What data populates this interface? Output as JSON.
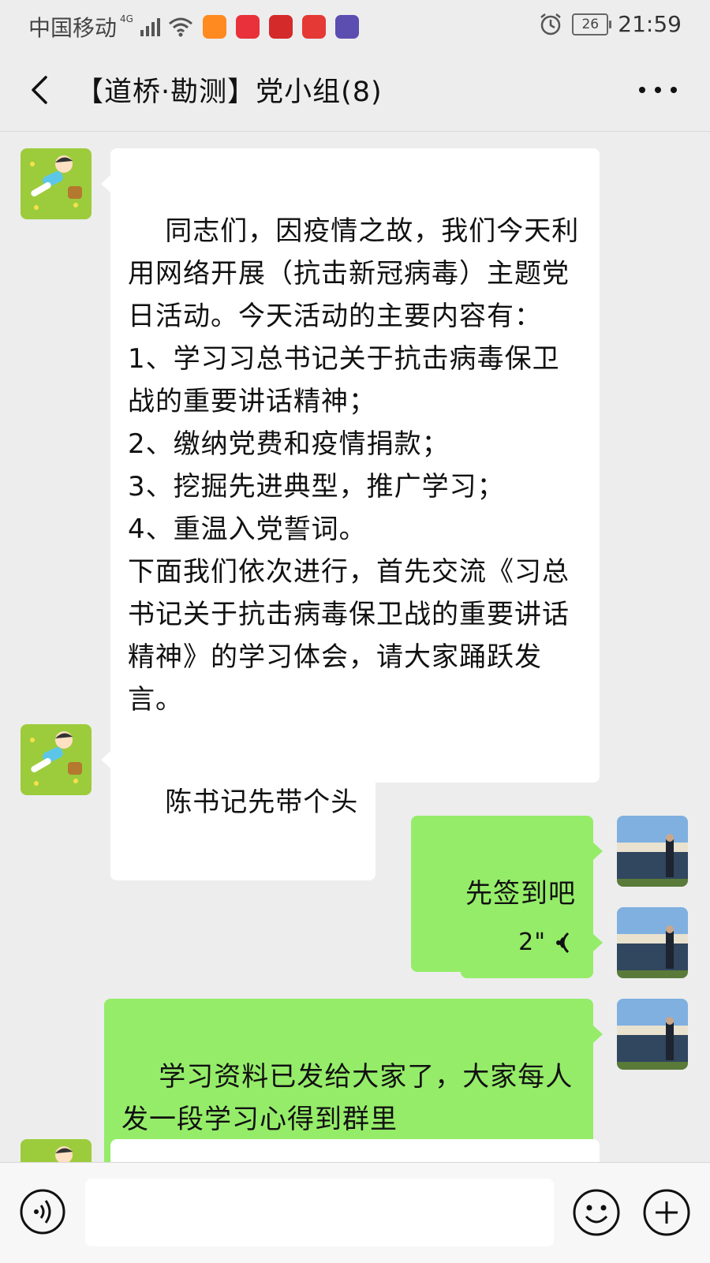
{
  "status_bar": {
    "carrier": "中国移动",
    "network": "4G",
    "battery": "26",
    "time": "21:59"
  },
  "header": {
    "title": "【道桥·勘测】党小组(8)",
    "back_icon": "chevron-left-icon",
    "more_icon": "more-horizontal-icon"
  },
  "messages": [
    {
      "side": "left",
      "text": "同志们，因疫情之故，我们今天利用网络开展（抗击新冠病毒）主题党日活动。今天活动的主要内容有：\n1、学习习总书记关于抗击病毒保卫战的重要讲话精神；\n2、缴纳党费和疫情捐款；\n3、挖掘先进典型，推广学习；\n4、重温入党誓词。\n下面我们依次进行，首先交流《习总书记关于抗击病毒保卫战的重要讲话精神》的学习体会，请大家踊跃发言。"
    },
    {
      "side": "left",
      "text": "陈书记先带个头"
    },
    {
      "side": "right",
      "text": "先签到吧"
    },
    {
      "side": "right",
      "type": "voice",
      "duration": "2\""
    },
    {
      "side": "right",
      "text": "学习资料已发给大家了，大家每人发一段学习心得到群里"
    }
  ],
  "input_bar": {
    "voice_icon": "voice-mode-icon",
    "emoji_icon": "emoji-icon",
    "plus_icon": "plus-circle-icon",
    "placeholder": ""
  },
  "colors": {
    "background": "#ededed",
    "bubble_self": "#95ec69",
    "bubble_other": "#ffffff"
  }
}
